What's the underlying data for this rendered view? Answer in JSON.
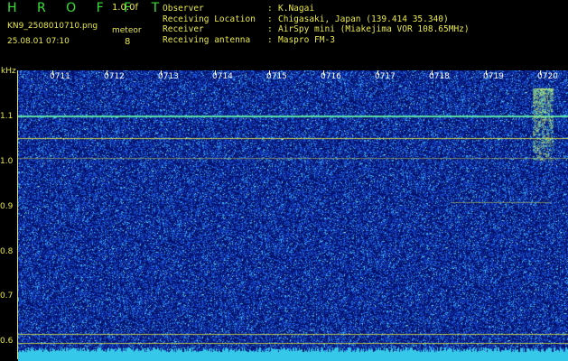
{
  "header": {
    "logo": "H R O F F T",
    "version": "1.0.0f",
    "filename": "KN9_2508010710.png",
    "meteor_label": "meteor",
    "meteor_count": "8",
    "datetime": "25.08.01 07:10",
    "info": [
      {
        "key": "Observer",
        "value": "K.Nagai"
      },
      {
        "key": "Receiving Location",
        "value": "Chigasaki, Japan (139.414 35.340)"
      },
      {
        "key": "Receiver",
        "value": "AirSpy mini (Miakejima VOR 108.65MHz)"
      },
      {
        "key": "Receiving antenna",
        "value": "Maspro FM-3"
      }
    ]
  },
  "spectrogram": {
    "freq_unit": "kHz",
    "freq_ticks": [
      "1.1",
      "1.0",
      "0.9",
      "0.8",
      "0.7",
      "0.6"
    ],
    "time_labels": [
      "0711",
      "0712",
      "0713",
      "0714",
      "0715",
      "0716",
      "0717",
      "0718",
      "0719",
      "0720"
    ],
    "colors": {
      "background": "#05126a",
      "noise_blue": "#1e4ad8",
      "noise_cyan": "#3fb9e8",
      "line_yellow": "#d7e24a",
      "line_green": "#5be2a8",
      "baseline": "#36c8e8"
    }
  }
}
